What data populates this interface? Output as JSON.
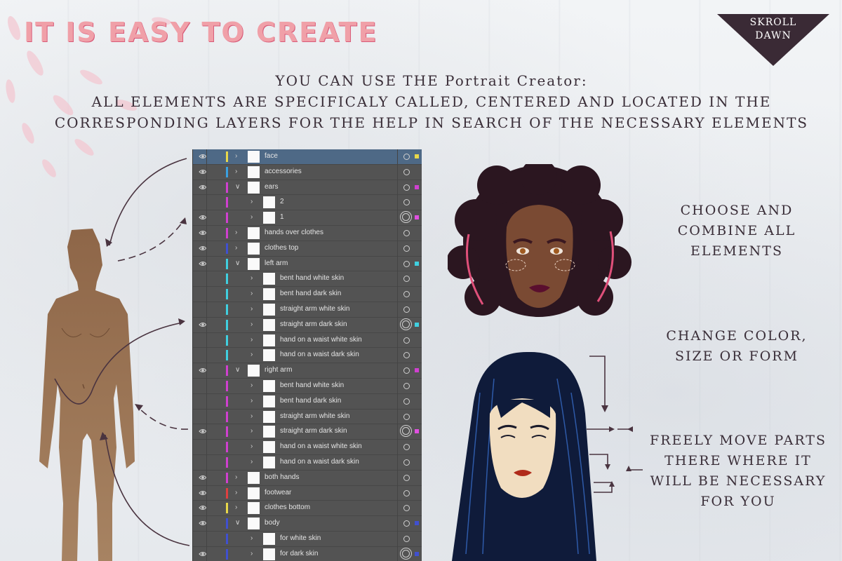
{
  "headline": "IT IS EASY TO CREATE",
  "badge": {
    "line1": "SKROLL",
    "line2": "DAWN"
  },
  "subtitle": {
    "line1": "YOU CAN USE THE Portrait Creator:",
    "line2": "ALL ELEMENTS ARE SPECIFICALY CALLED, CENTERED AND LOCATED IN THE",
    "line3": "CORRESPONDING LAYERS FOR THE HELP IN SEARCH OF THE NECESSARY ELEMENTS"
  },
  "captions": {
    "choose": [
      "CHOOSE AND",
      "COMBINE ALL",
      "ELEMENTS"
    ],
    "change": [
      "CHANGE COLOR,",
      "SIZE OR FORM"
    ],
    "move": [
      "FREELY MOVE PARTS",
      "THERE WHERE IT",
      "WILL BE NECESSARY",
      "FOR YOU"
    ]
  },
  "colors": {
    "headline": "#f0a0a8",
    "badge_bg": "#3a2a35",
    "panel_bg": "#535353",
    "selected_row": "#4e6986",
    "text_dark": "#3a2e38"
  },
  "layers": [
    {
      "name": "face",
      "eye": true,
      "indent": 0,
      "expanded": false,
      "color": "#e8d84a",
      "square": "#e8d84a",
      "selected": true,
      "ring": "single"
    },
    {
      "name": "accessories",
      "eye": true,
      "indent": 0,
      "expanded": false,
      "color": "#3aa0e0",
      "square": "",
      "selected": false,
      "ring": "single"
    },
    {
      "name": "ears",
      "eye": true,
      "indent": 0,
      "expanded": true,
      "color": "#d040d0",
      "square": "#d040d0",
      "selected": false,
      "ring": "single"
    },
    {
      "name": "2",
      "eye": false,
      "indent": 1,
      "expanded": false,
      "color": "#d040d0",
      "square": "",
      "selected": false,
      "ring": "single"
    },
    {
      "name": "1",
      "eye": true,
      "indent": 1,
      "expanded": false,
      "color": "#d040d0",
      "square": "#e050e0",
      "selected": false,
      "ring": "double"
    },
    {
      "name": "hands over clothes",
      "eye": true,
      "indent": 0,
      "expanded": false,
      "color": "#d040d0",
      "square": "",
      "selected": false,
      "ring": "single"
    },
    {
      "name": "clothes top",
      "eye": true,
      "indent": 0,
      "expanded": false,
      "color": "#4050d0",
      "square": "",
      "selected": false,
      "ring": "single"
    },
    {
      "name": "left arm",
      "eye": true,
      "indent": 0,
      "expanded": true,
      "color": "#40d0e0",
      "square": "#40d0e0",
      "selected": false,
      "ring": "single"
    },
    {
      "name": "bent hand white skin",
      "eye": false,
      "indent": 1,
      "expanded": false,
      "color": "#40d0e0",
      "square": "",
      "selected": false,
      "ring": "single"
    },
    {
      "name": "bent hand dark skin",
      "eye": false,
      "indent": 1,
      "expanded": false,
      "color": "#40d0e0",
      "square": "",
      "selected": false,
      "ring": "single"
    },
    {
      "name": "straight arm white skin",
      "eye": false,
      "indent": 1,
      "expanded": false,
      "color": "#40d0e0",
      "square": "",
      "selected": false,
      "ring": "single"
    },
    {
      "name": "straight arm dark skin",
      "eye": true,
      "indent": 1,
      "expanded": false,
      "color": "#40d0e0",
      "square": "#40d0e0",
      "selected": false,
      "ring": "double"
    },
    {
      "name": "hand on a waist white skin",
      "eye": false,
      "indent": 1,
      "expanded": false,
      "color": "#40d0e0",
      "square": "",
      "selected": false,
      "ring": "single"
    },
    {
      "name": "hand on a waist dark skin",
      "eye": false,
      "indent": 1,
      "expanded": false,
      "color": "#40d0e0",
      "square": "",
      "selected": false,
      "ring": "single"
    },
    {
      "name": "right arm",
      "eye": true,
      "indent": 0,
      "expanded": true,
      "color": "#d040d0",
      "square": "#d040d0",
      "selected": false,
      "ring": "single"
    },
    {
      "name": "bent hand white skin",
      "eye": false,
      "indent": 1,
      "expanded": false,
      "color": "#d040d0",
      "square": "",
      "selected": false,
      "ring": "single"
    },
    {
      "name": "bent hand dark skin",
      "eye": false,
      "indent": 1,
      "expanded": false,
      "color": "#d040d0",
      "square": "",
      "selected": false,
      "ring": "single"
    },
    {
      "name": "straight arm white skin",
      "eye": false,
      "indent": 1,
      "expanded": false,
      "color": "#d040d0",
      "square": "",
      "selected": false,
      "ring": "single"
    },
    {
      "name": "straight arm dark skin",
      "eye": true,
      "indent": 1,
      "expanded": false,
      "color": "#d040d0",
      "square": "#e050e0",
      "selected": false,
      "ring": "double"
    },
    {
      "name": "hand on a waist white skin",
      "eye": false,
      "indent": 1,
      "expanded": false,
      "color": "#d040d0",
      "square": "",
      "selected": false,
      "ring": "single"
    },
    {
      "name": "hand on a waist dark skin",
      "eye": false,
      "indent": 1,
      "expanded": false,
      "color": "#d040d0",
      "square": "",
      "selected": false,
      "ring": "single"
    },
    {
      "name": "both hands",
      "eye": true,
      "indent": 0,
      "expanded": false,
      "color": "#d040d0",
      "square": "",
      "selected": false,
      "ring": "single"
    },
    {
      "name": "footwear",
      "eye": true,
      "indent": 0,
      "expanded": false,
      "color": "#e04040",
      "square": "",
      "selected": false,
      "ring": "single"
    },
    {
      "name": "clothes bottom",
      "eye": true,
      "indent": 0,
      "expanded": false,
      "color": "#e8d84a",
      "square": "",
      "selected": false,
      "ring": "single"
    },
    {
      "name": "body",
      "eye": true,
      "indent": 0,
      "expanded": true,
      "color": "#4050d0",
      "square": "#4050d0",
      "selected": false,
      "ring": "single"
    },
    {
      "name": "for white skin",
      "eye": false,
      "indent": 1,
      "expanded": false,
      "color": "#4050d0",
      "square": "",
      "selected": false,
      "ring": "single"
    },
    {
      "name": "for dark skin",
      "eye": true,
      "indent": 1,
      "expanded": false,
      "color": "#4050d0",
      "square": "#4050d0",
      "selected": false,
      "ring": "double"
    }
  ]
}
